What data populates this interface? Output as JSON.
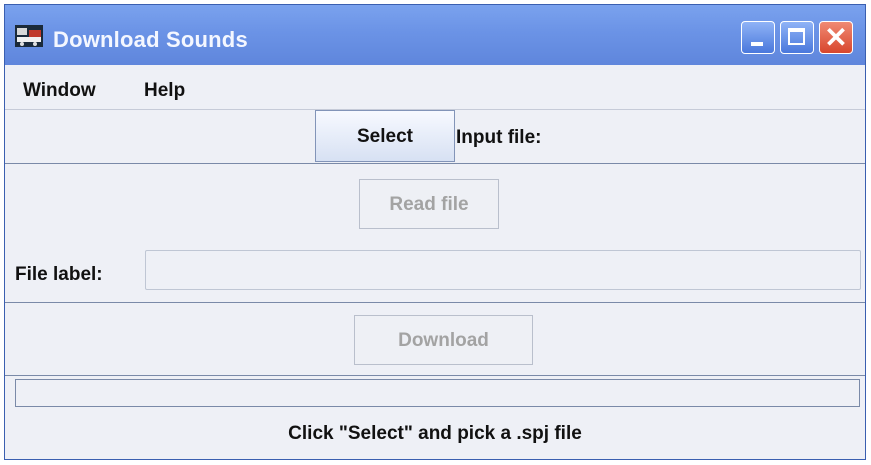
{
  "window": {
    "title": "Download Sounds"
  },
  "menu": {
    "items": [
      "Window",
      "Help"
    ]
  },
  "select_row": {
    "button_label": "Select",
    "input_label": "Input file:"
  },
  "read_row": {
    "button_label": "Read file"
  },
  "file_label_row": {
    "label": "File label:",
    "value": ""
  },
  "download_row": {
    "button_label": "Download"
  },
  "progress": {
    "value": 0
  },
  "status": {
    "text": "Click \"Select\" and pick a .spj file"
  }
}
